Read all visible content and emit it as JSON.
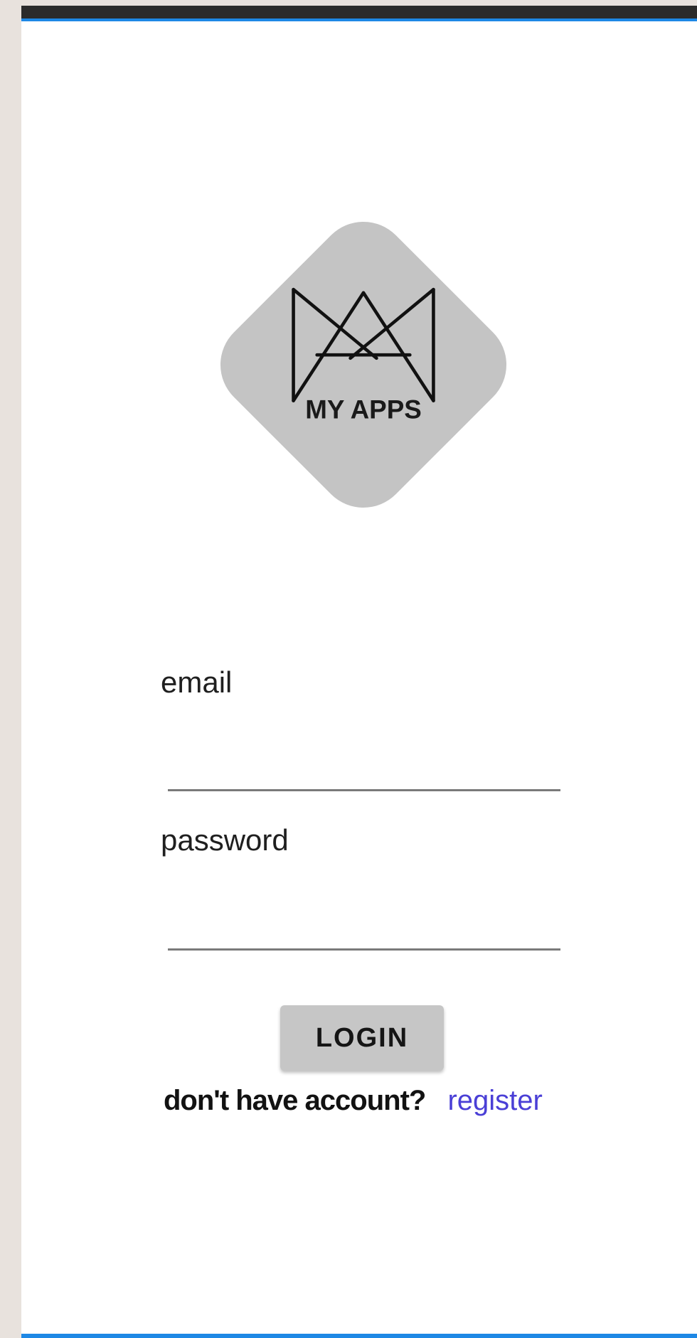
{
  "app": {
    "logo_text": "MY APPS",
    "logo_icon": "crown-icon"
  },
  "form": {
    "email_label": "email",
    "email_value": "",
    "password_label": "password",
    "password_value": "",
    "login_label": "LOGIN"
  },
  "footer": {
    "prompt": "don't have account?",
    "register_label": "register"
  },
  "colors": {
    "accent": "#1e88e5",
    "logo_bg": "#c4c4c4",
    "button_bg": "#c6c6c6",
    "link": "#4a3fd6"
  }
}
